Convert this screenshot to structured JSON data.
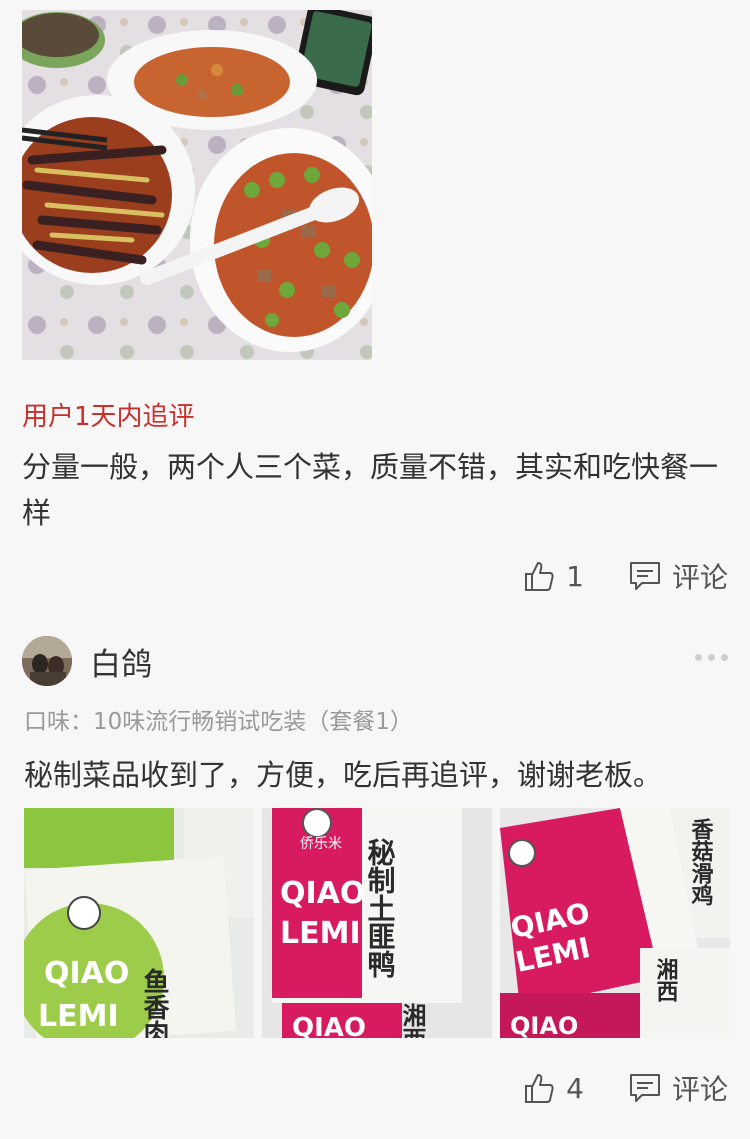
{
  "followup": {
    "label": "用户1天内追评",
    "text": "分量一般，两个人三个菜，质量不错，其实和吃快餐一样",
    "like_count": "1",
    "comment_label": "评论"
  },
  "review": {
    "reviewer_name": "白鸽",
    "flavor": "口味：10味流行畅销试吃装（套餐1）",
    "text": "秘制菜品收到了，方便，吃后再追评，谢谢老板。",
    "like_count": "4",
    "comment_label": "评论"
  },
  "package_text": {
    "brand_cn": "侨乐米",
    "brand_en_1": "QIAO",
    "brand_en_2": "LEMI",
    "dish_1": "鱼香肉",
    "dish_2": "秘制土匪鸭",
    "dish_3": "湘西",
    "dish_4": "香菇滑鸡"
  },
  "icons": {
    "like": "thumbs-up-icon",
    "comment": "comment-icon",
    "more": "more-dots-icon"
  },
  "colors": {
    "accent_red": "#c9302c",
    "text_primary": "#333333",
    "text_secondary": "#9a9a9a",
    "package_green": "#8cc63f",
    "package_pink": "#d81b60"
  }
}
